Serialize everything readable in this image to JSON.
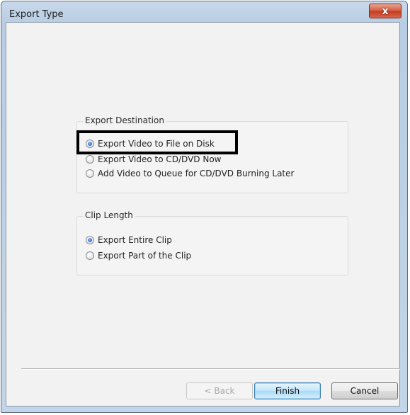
{
  "window": {
    "title": "Export Type",
    "close_label": "x"
  },
  "export_destination": {
    "label": "Export Destination",
    "options": [
      {
        "label": "Export Video to File on Disk",
        "checked": true
      },
      {
        "label": "Export Video to CD/DVD Now",
        "checked": false
      },
      {
        "label": "Add Video to Queue for CD/DVD Burning Later",
        "checked": false
      }
    ]
  },
  "clip_length": {
    "label": "Clip Length",
    "options": [
      {
        "label": "Export Entire Clip",
        "checked": true
      },
      {
        "label": "Export Part of the Clip",
        "checked": false
      }
    ]
  },
  "buttons": {
    "back": "< Back",
    "finish": "Finish",
    "cancel": "Cancel"
  }
}
